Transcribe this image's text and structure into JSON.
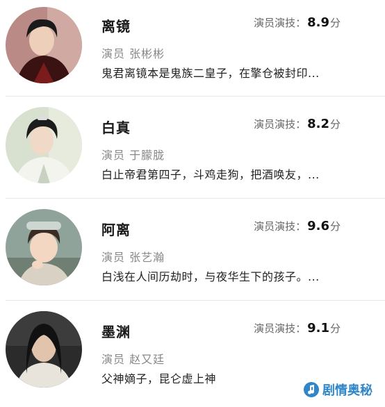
{
  "characters": [
    {
      "name": "离镜",
      "score_label": "演员演技：",
      "score": "8.9",
      "score_unit": "分",
      "actor": "演员 张彬彬",
      "desc": "鬼君离镜本是鬼族二皇子，在擎仓被封印..."
    },
    {
      "name": "白真",
      "score_label": "演员演技：",
      "score": "8.2",
      "score_unit": "分",
      "actor": "演员 于朦胧",
      "desc": "白止帝君第四子，斗鸡走狗，把酒唤友，..."
    },
    {
      "name": "阿离",
      "score_label": "演员演技：",
      "score": "9.6",
      "score_unit": "分",
      "actor": "演员 张艺瀚",
      "desc": "白浅在人间历劫时，与夜华生下的孩子。..."
    },
    {
      "name": "墨渊",
      "score_label": "演员演技：",
      "score": "9.1",
      "score_unit": "分",
      "actor": "演员 赵又廷",
      "desc": "父神嫡子，昆仑虚上神"
    }
  ],
  "watermark": {
    "text": "剧情奥秘",
    "icon": "music-note-logo-icon",
    "color": "#2f86c9"
  }
}
